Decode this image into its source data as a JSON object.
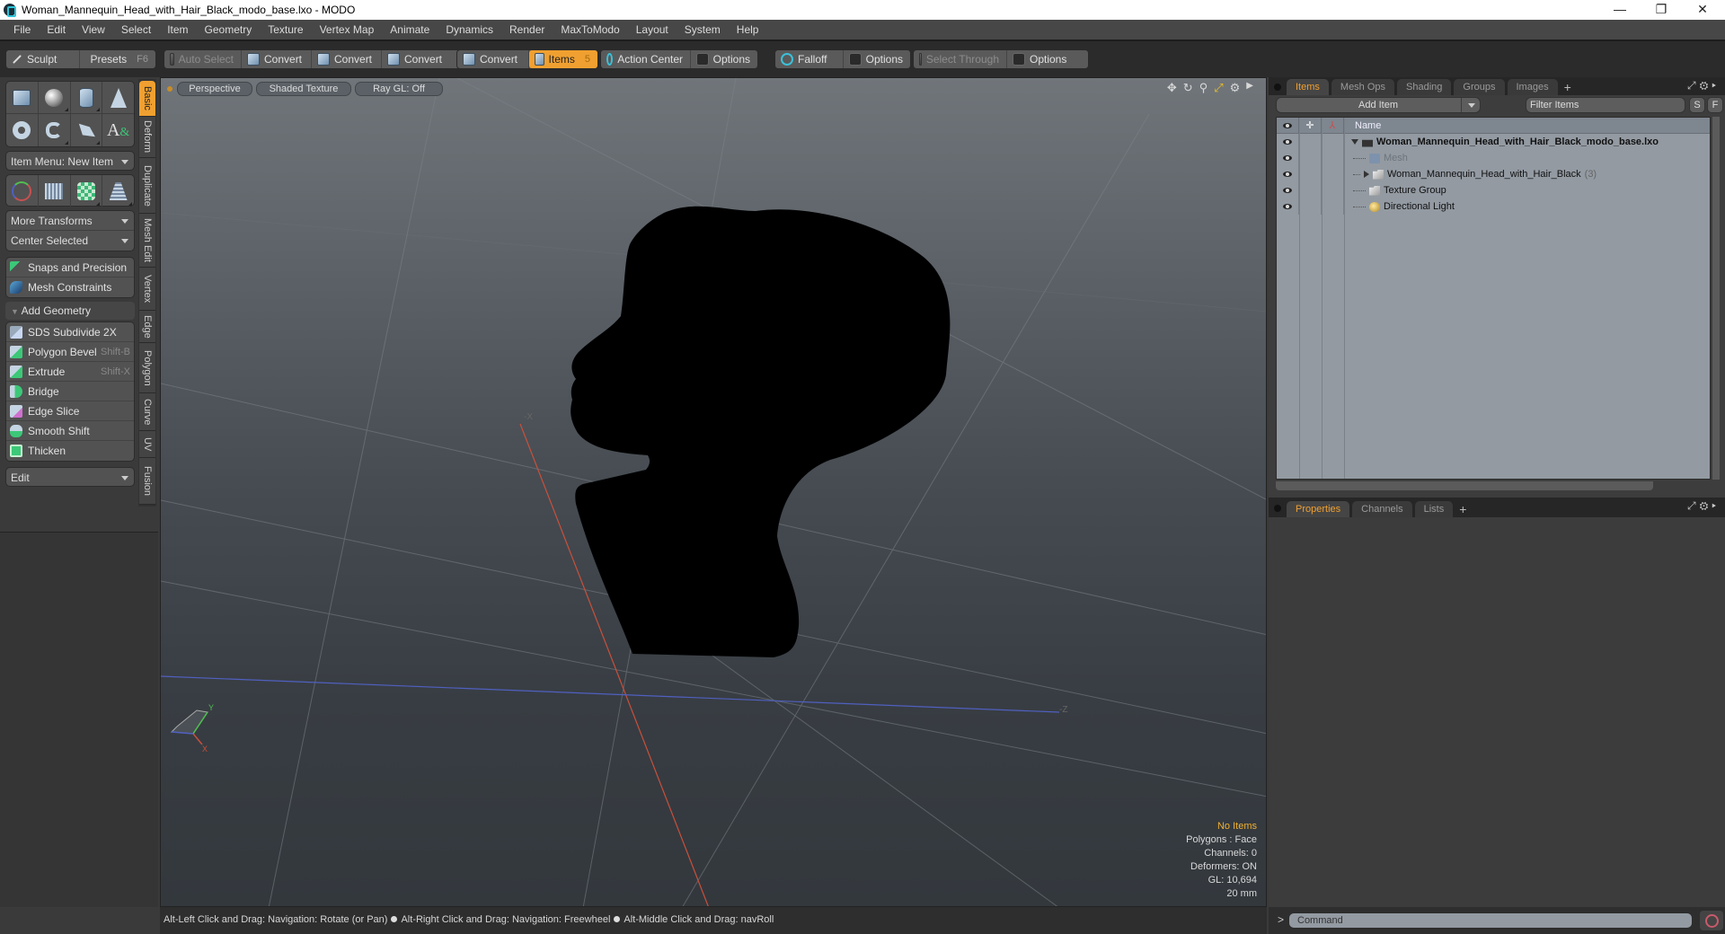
{
  "window": {
    "title": "Woman_Mannequin_Head_with_Hair_Black_modo_base.lxo - MODO",
    "controls": {
      "minimize": "—",
      "maximize": "❐",
      "close": "✕"
    }
  },
  "menu": [
    "File",
    "Edit",
    "View",
    "Select",
    "Item",
    "Geometry",
    "Texture",
    "Vertex Map",
    "Animate",
    "Dynamics",
    "Render",
    "MaxToModo",
    "Layout",
    "System",
    "Help"
  ],
  "toolbar": {
    "sculpt": "Sculpt",
    "presets": "Presets",
    "presets_hotkey": "F6",
    "auto_select": "Auto Select",
    "convert_1": "Convert",
    "convert_2": "Convert",
    "convert_3": "Convert",
    "convert_4": "Convert",
    "items": "Items",
    "items_hotkey": "5",
    "action_center": "Action Center",
    "options_1": "Options",
    "falloff": "Falloff",
    "options_2": "Options",
    "select_through": "Select Through",
    "options_3": "Options"
  },
  "left_panel": {
    "item_menu": "Item Menu: New Item",
    "more_transforms": "More Transforms",
    "center_selected": "Center Selected",
    "snaps": "Snaps and Precision",
    "mesh_constraints": "Mesh Constraints",
    "add_geometry": "Add Geometry",
    "tools": [
      {
        "label": "SDS Subdivide 2X",
        "hotkey": ""
      },
      {
        "label": "Polygon Bevel",
        "hotkey": "Shift-B"
      },
      {
        "label": "Extrude",
        "hotkey": "Shift-X"
      },
      {
        "label": "Bridge",
        "hotkey": ""
      },
      {
        "label": "Edge Slice",
        "hotkey": ""
      },
      {
        "label": "Smooth Shift",
        "hotkey": ""
      },
      {
        "label": "Thicken",
        "hotkey": ""
      }
    ],
    "edit_dropdown": "Edit",
    "side_tabs": [
      "Basic",
      "Deform",
      "Duplicate",
      "Mesh Edit",
      "Vertex",
      "Edge",
      "Polygon",
      "Curve",
      "UV",
      "Fusion"
    ]
  },
  "viewport": {
    "view_mode": "Perspective",
    "shading": "Shaded Texture",
    "raygl": "Ray GL: Off",
    "info": {
      "selection": "No Items",
      "polygons": "Polygons : Face",
      "channels": "Channels: 0",
      "deformers": "Deformers: ON",
      "gl": "GL: 10,694",
      "unit": "20 mm"
    },
    "axis_labels": {
      "x": "X",
      "y": "Y",
      "neg_x": "-X",
      "neg_z": "-Z"
    },
    "colors": {
      "x_axis": "#c8503c",
      "z_axis": "#5060c0",
      "y_axis": "#50c050",
      "accent": "#f0a030"
    }
  },
  "status_bar": {
    "hint_1": "Alt-Left Click and Drag: Navigation: Rotate (or Pan)",
    "hint_2": "Alt-Right Click and Drag: Navigation: Freewheel",
    "hint_3": "Alt-Middle Click and Drag: navRoll"
  },
  "right_panel": {
    "tabs": [
      "Items",
      "Mesh Ops",
      "Shading",
      "Groups",
      "Images"
    ],
    "add_item": "Add Item",
    "filter_placeholder": "Filter Items",
    "s_button": "S",
    "f_button": "F",
    "name_header": "Name",
    "tree": [
      {
        "label": "Woman_Mannequin_Head_with_Hair_Black_modo_base.lxo",
        "count": "",
        "type": "scene"
      },
      {
        "label": "Mesh",
        "count": "",
        "type": "mesh"
      },
      {
        "label": "Woman_Mannequin_Head_with_Hair_Black",
        "count": "(3)",
        "type": "group"
      },
      {
        "label": "Texture Group",
        "count": "",
        "type": "group"
      },
      {
        "label": "Directional Light",
        "count": "",
        "type": "light"
      }
    ],
    "bottom_tabs": [
      "Properties",
      "Channels",
      "Lists"
    ],
    "command_prompt": ">",
    "command_placeholder": "Command"
  }
}
